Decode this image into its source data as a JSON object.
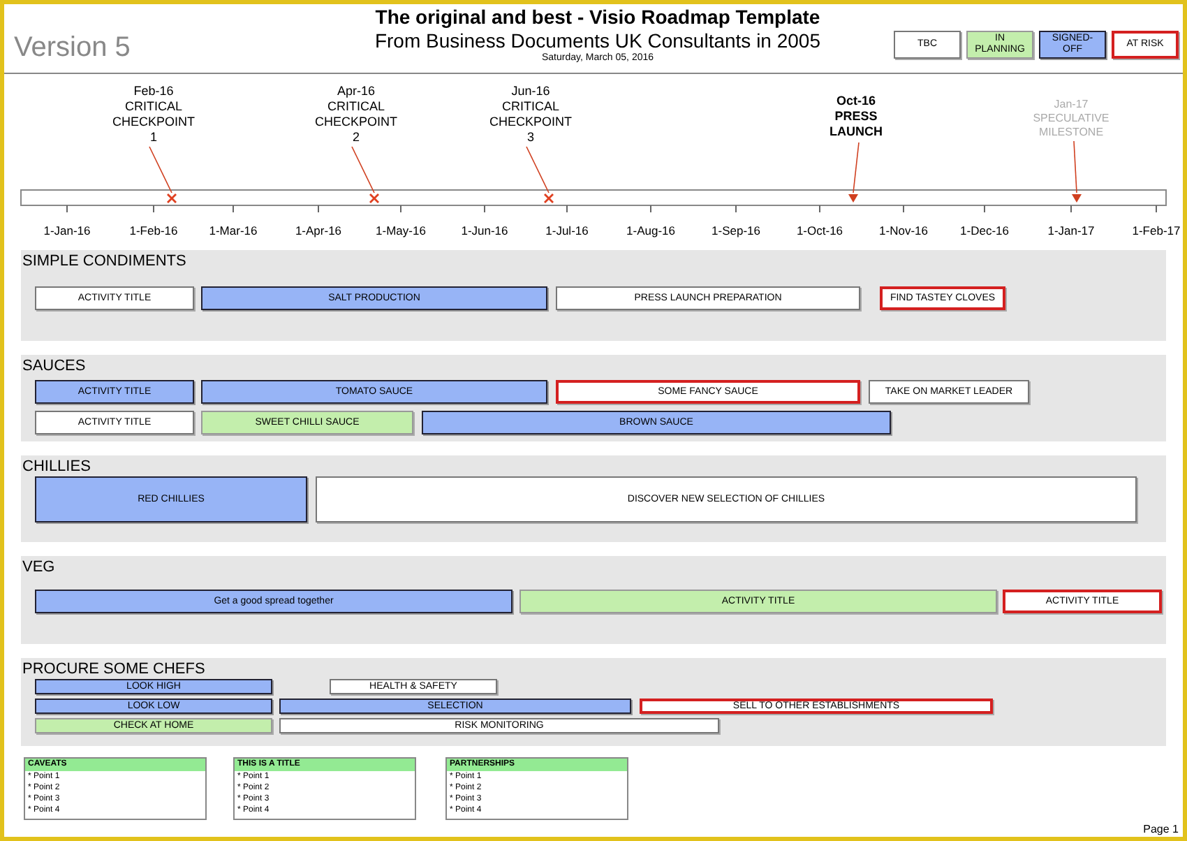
{
  "header": {
    "version": "Version 5",
    "title": "The original and best - Visio Roadmap Template",
    "subtitle": "From Business Documents UK Consultants in 2005",
    "date": "Saturday, March 05, 2016"
  },
  "legend": [
    {
      "label": "TBC",
      "kind": "tbc"
    },
    {
      "label": "IN PLANNING",
      "kind": "planning"
    },
    {
      "label": "SIGNED-OFF",
      "kind": "signed"
    },
    {
      "label": "AT RISK",
      "kind": "risk"
    }
  ],
  "milestones": [
    {
      "kind": "checkpoint",
      "label": "Feb-16\nCRITICAL\nCHECKPOINT\n1"
    },
    {
      "kind": "checkpoint",
      "label": "Apr-16\nCRITICAL\nCHECKPOINT\n2"
    },
    {
      "kind": "checkpoint",
      "label": "Jun-16\nCRITICAL\nCHECKPOINT\n3"
    },
    {
      "kind": "launch",
      "label": "Oct-16\nPRESS\nLAUNCH"
    },
    {
      "kind": "speculative",
      "label": "Jan-17\nSPECULATIVE\nMILESTONE"
    }
  ],
  "timeline": {
    "months": [
      "1-Jan-16",
      "1-Feb-16",
      "1-Mar-16",
      "1-Apr-16",
      "1-May-16",
      "1-Jun-16",
      "1-Jul-16",
      "1-Aug-16",
      "1-Sep-16",
      "1-Oct-16",
      "1-Nov-16",
      "1-Dec-16",
      "1-Jan-17",
      "1-Feb-17"
    ]
  },
  "lanes": [
    {
      "title": "SIMPLE CONDIMENTS",
      "rows": [
        [
          {
            "label": "ACTIVITY TITLE",
            "kind": "tbc"
          },
          {
            "label": "SALT PRODUCTION",
            "kind": "signed"
          },
          {
            "label": "PRESS LAUNCH PREPARATION",
            "kind": "tbc"
          },
          {
            "label": "FIND TASTEY CLOVES",
            "kind": "risk"
          }
        ]
      ]
    },
    {
      "title": "SAUCES",
      "rows": [
        [
          {
            "label": "ACTIVITY TITLE",
            "kind": "signed"
          },
          {
            "label": "TOMATO SAUCE",
            "kind": "signed"
          },
          {
            "label": "SOME FANCY SAUCE",
            "kind": "risk"
          },
          {
            "label": "TAKE ON MARKET LEADER",
            "kind": "tbc"
          }
        ],
        [
          {
            "label": "ACTIVITY TITLE",
            "kind": "tbc"
          },
          {
            "label": "SWEET CHILLI SAUCE",
            "kind": "planning"
          },
          {
            "label": "BROWN SAUCE",
            "kind": "signed"
          }
        ]
      ]
    },
    {
      "title": "CHILLIES",
      "rows": [
        [
          {
            "label": "RED CHILLIES",
            "kind": "signed"
          },
          {
            "label": "DISCOVER NEW SELECTION OF CHILLIES",
            "kind": "tbc"
          }
        ]
      ]
    },
    {
      "title": "VEG",
      "rows": [
        [
          {
            "label": "Get a good spread together",
            "kind": "signed"
          },
          {
            "label": "ACTIVITY TITLE",
            "kind": "planning"
          },
          {
            "label": "ACTIVITY TITLE",
            "kind": "risk"
          }
        ]
      ]
    },
    {
      "title": "PROCURE SOME CHEFS",
      "rows": [
        [
          {
            "label": "LOOK HIGH",
            "kind": "signed"
          },
          {
            "label": "HEALTH & SAFETY",
            "kind": "tbc"
          }
        ],
        [
          {
            "label": "LOOK LOW",
            "kind": "signed"
          },
          {
            "label": "SELECTION",
            "kind": "signed"
          },
          {
            "label": "SELL TO OTHER ESTABLISHMENTS",
            "kind": "risk"
          }
        ],
        [
          {
            "label": "CHECK AT HOME",
            "kind": "planning"
          },
          {
            "label": "RISK MONITORING",
            "kind": "tbc"
          }
        ]
      ]
    }
  ],
  "notes": [
    {
      "title": "CAVEATS",
      "points": [
        "* Point 1",
        "* Point 2",
        "* Point 3",
        "* Point 4"
      ]
    },
    {
      "title": "THIS IS A TITLE",
      "points": [
        "* Point 1",
        "* Point 2",
        "* Point 3",
        "* Point 4"
      ]
    },
    {
      "title": "PARTNERSHIPS",
      "points": [
        "* Point 1",
        "* Point 2",
        "* Point 3",
        "* Point 4"
      ]
    }
  ],
  "page": "Page 1"
}
